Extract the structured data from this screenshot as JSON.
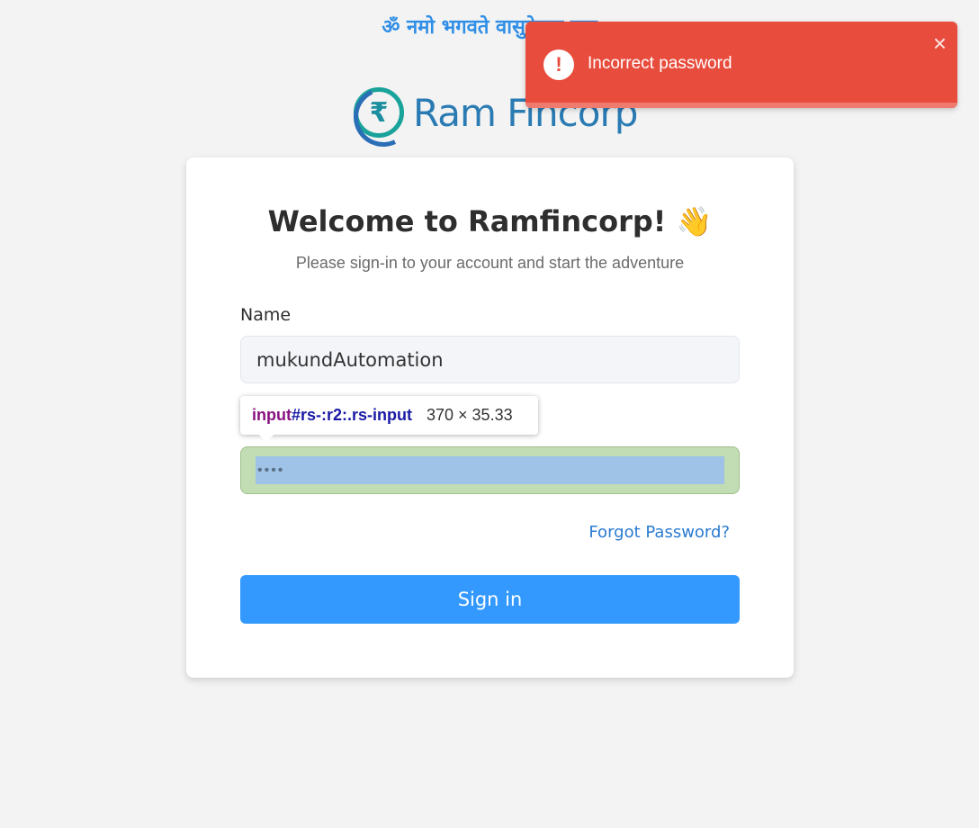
{
  "header": {
    "mantra": "ॐ नमो भगवते वासुदेवाय नमः"
  },
  "logo": {
    "symbol": "₹",
    "name": "Ram Fincorp"
  },
  "card": {
    "title": "Welcome to Ramfincorp! 👋",
    "subtitle": "Please sign-in to your account and start the adventure",
    "name_label": "Name",
    "name_value": "mukundAutomation",
    "password_value": "••••",
    "forgot_link": "Forgot Password?",
    "signin_button": "Sign in"
  },
  "inspector_tooltip": {
    "tag": "input",
    "selector": "#rs-:r2:.rs-input",
    "size": "370 × 35.33"
  },
  "toast": {
    "message": "Incorrect password",
    "icon": "!",
    "close": "×",
    "progress": 1.0,
    "color": "#e84c3d"
  }
}
